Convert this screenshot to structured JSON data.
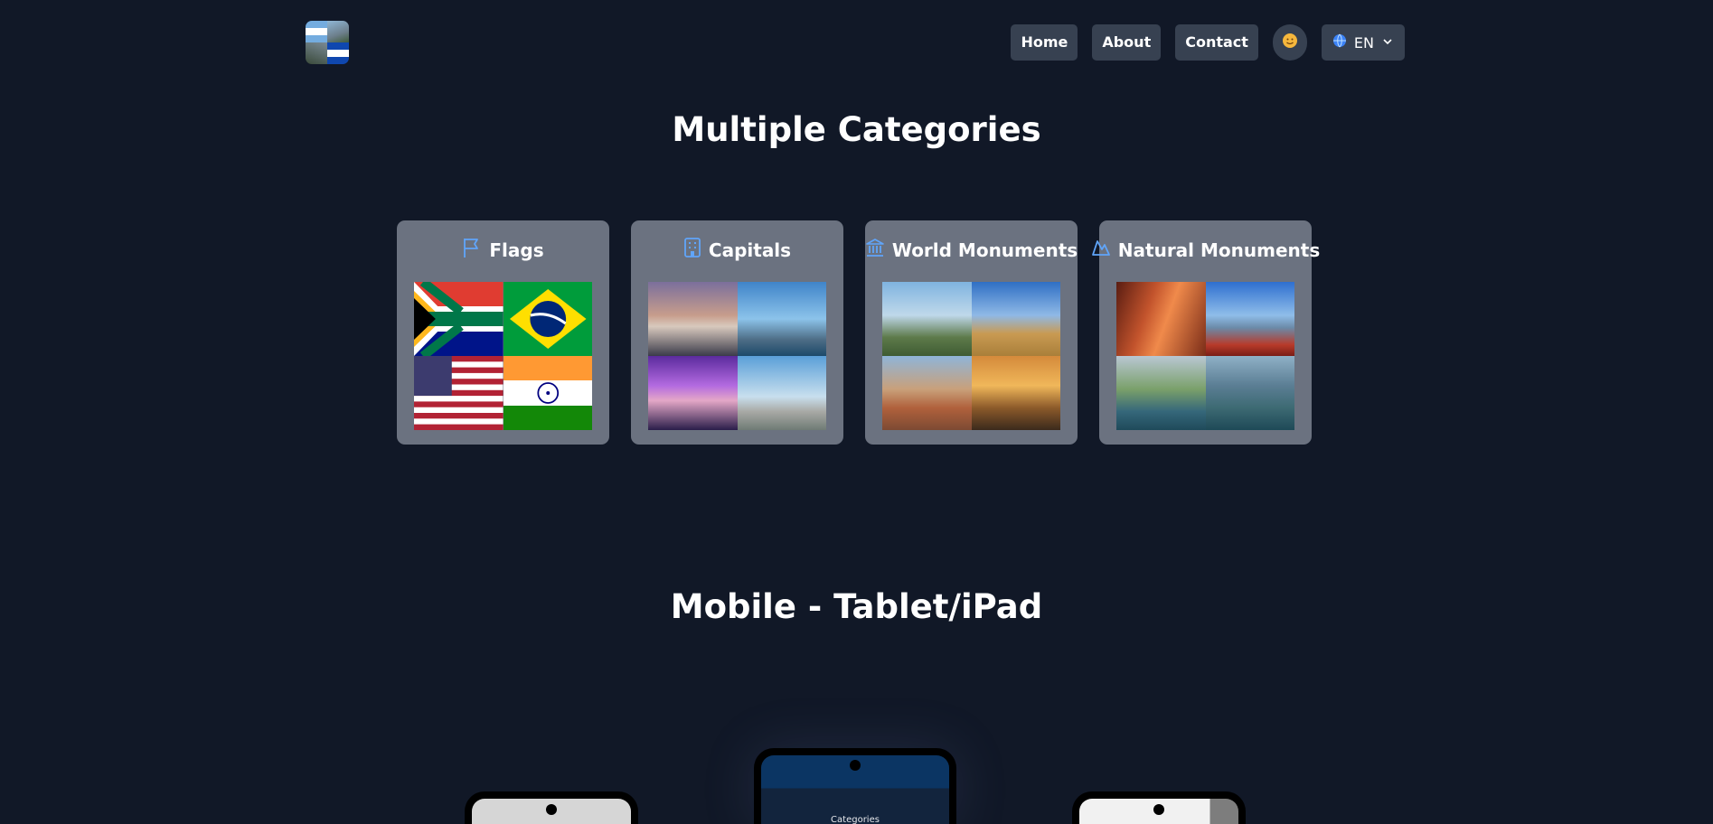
{
  "header": {
    "logo_alt": "",
    "nav": [
      {
        "label": "Home"
      },
      {
        "label": "About"
      },
      {
        "label": "Contact"
      }
    ],
    "theme_icon": "sun-face-icon",
    "language": {
      "icon": "globe-icon",
      "label": "EN",
      "chevron": "chevron-down-icon"
    }
  },
  "sections": {
    "categories_title": "Multiple Categories",
    "mobile_title": "Mobile - Tablet/iPad"
  },
  "categories": [
    {
      "label": "Flags",
      "icon": "flag-icon"
    },
    {
      "label": "Capitals",
      "icon": "building-icon"
    },
    {
      "label": "World Monuments",
      "icon": "landmark-icon"
    },
    {
      "label": "Natural Monuments",
      "icon": "mountain-icon"
    }
  ],
  "phones": {
    "center_screen_label": "Categories"
  },
  "colors": {
    "background": "#111827",
    "nav_button": "#374151",
    "card": "#6b7280",
    "icon_accent": "#60a5fa"
  }
}
